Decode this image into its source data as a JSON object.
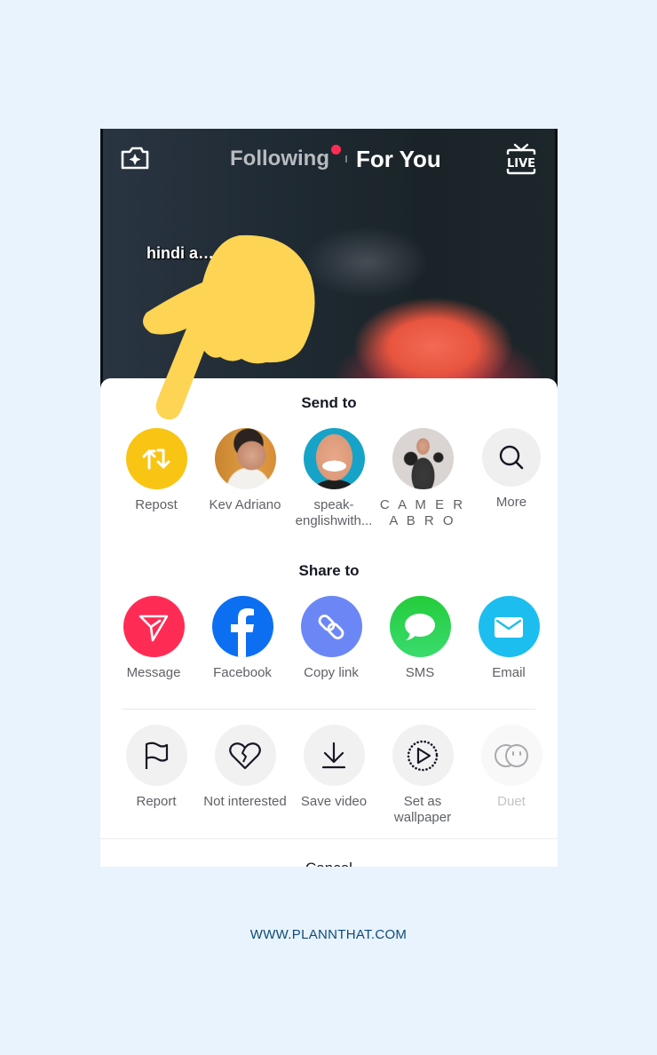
{
  "header": {
    "tabs": [
      {
        "label": "Following",
        "active": false,
        "has_notification_dot": true
      },
      {
        "label": "For You",
        "active": true
      }
    ],
    "left_icon": "camera-sparkle-icon",
    "right_icon": "live-tv-icon",
    "right_icon_text": "LIVE"
  },
  "video": {
    "caption_visible": "hindi a… …ras pt5"
  },
  "share_sheet": {
    "send_to": {
      "title": "Send to",
      "items": [
        {
          "label": "Repost",
          "icon": "repost-icon",
          "color": "#f9c514"
        },
        {
          "label": "Kev Adriano",
          "icon": "avatar",
          "color": "#d48a2e"
        },
        {
          "label": "speak-englishwith...",
          "icon": "avatar",
          "color": "#1aa3c9"
        },
        {
          "label": "C A M E R A B R O",
          "icon": "avatar",
          "color": "#d8d3d1"
        },
        {
          "label": "More",
          "icon": "search-icon",
          "color": "#efefef"
        }
      ]
    },
    "share_to": {
      "title": "Share to",
      "items": [
        {
          "label": "Message",
          "icon": "send-message-icon",
          "color": "#fe2c55"
        },
        {
          "label": "Facebook",
          "icon": "facebook-icon",
          "color": "#0c6ff2"
        },
        {
          "label": "Copy link",
          "icon": "link-icon",
          "color": "#6b87f6"
        },
        {
          "label": "SMS",
          "icon": "sms-bubble-icon",
          "color": "#2dd14f"
        },
        {
          "label": "Email",
          "icon": "mail-icon",
          "color": "#1cbef0"
        }
      ]
    },
    "actions": {
      "items": [
        {
          "label": "Report",
          "icon": "flag-icon",
          "disabled": false
        },
        {
          "label": "Not interested",
          "icon": "broken-heart-icon",
          "disabled": false
        },
        {
          "label": "Save video",
          "icon": "download-icon",
          "disabled": false
        },
        {
          "label": "Set as wallpaper",
          "icon": "play-wallpaper-icon",
          "disabled": false
        },
        {
          "label": "Duet",
          "icon": "duet-icon",
          "disabled": true
        }
      ]
    },
    "cancel_label": "Cancel"
  },
  "overlay": {
    "pointer": "pointing-hand-icon",
    "pointer_color": "#fdd453"
  },
  "footer": {
    "url": "WWW.PLANNTHAT.COM"
  }
}
